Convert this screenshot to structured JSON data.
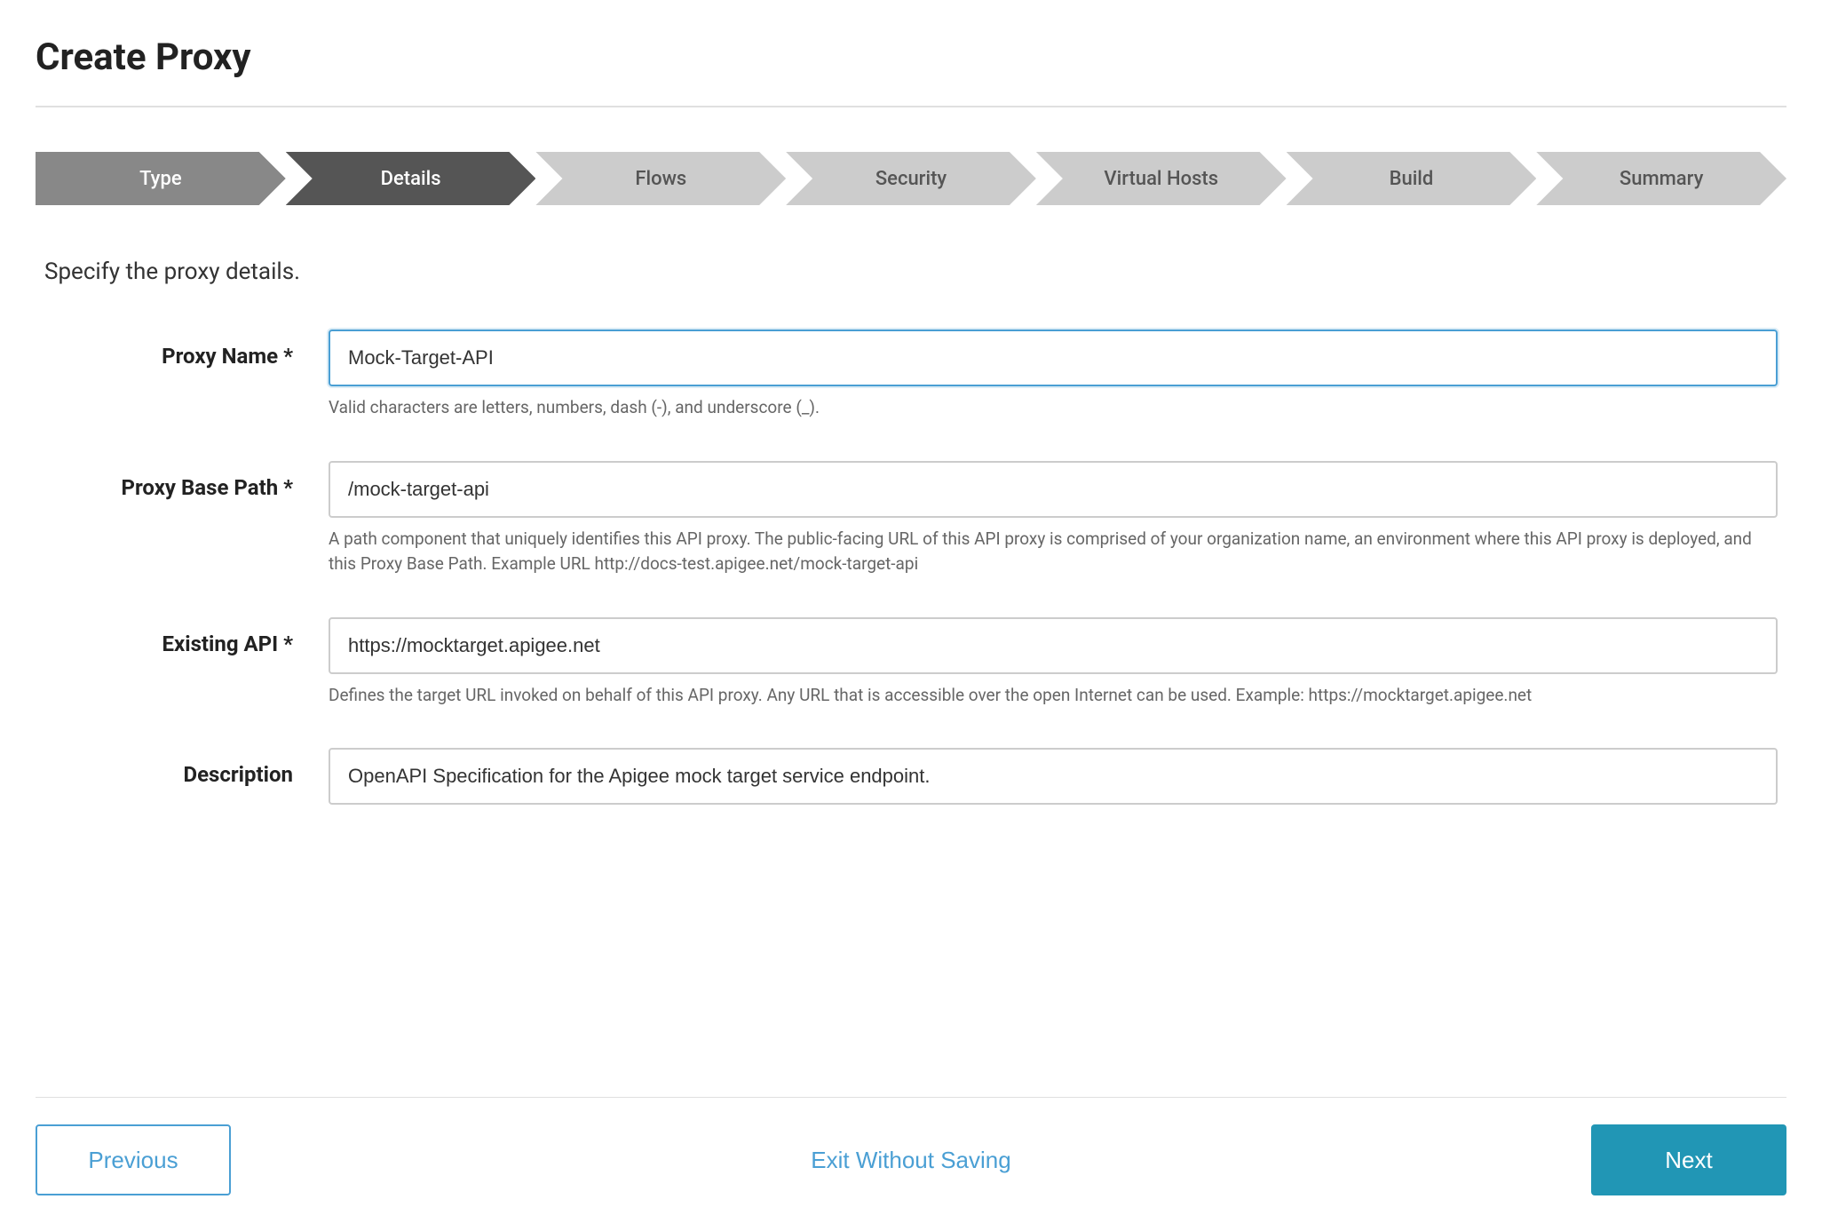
{
  "page": {
    "title": "Create Proxy"
  },
  "stepper": {
    "steps": [
      {
        "id": "type",
        "label": "Type",
        "state": "completed"
      },
      {
        "id": "details",
        "label": "Details",
        "state": "active"
      },
      {
        "id": "flows",
        "label": "Flows",
        "state": "inactive"
      },
      {
        "id": "security",
        "label": "Security",
        "state": "inactive"
      },
      {
        "id": "virtual-hosts",
        "label": "Virtual Hosts",
        "state": "inactive"
      },
      {
        "id": "build",
        "label": "Build",
        "state": "inactive"
      },
      {
        "id": "summary",
        "label": "Summary",
        "state": "inactive"
      }
    ]
  },
  "form": {
    "section_description": "Specify the proxy details.",
    "fields": {
      "proxy_name": {
        "label": "Proxy Name *",
        "value": "Mock-Target-API",
        "hint": "Valid characters are letters, numbers, dash (-), and underscore (_)."
      },
      "proxy_base_path": {
        "label": "Proxy Base Path *",
        "value": "/mock-target-api",
        "hint": "A path component that uniquely identifies this API proxy. The public-facing URL of this API proxy is comprised of your organization name, an environment where this API proxy is deployed, and this Proxy Base Path. Example URL http://docs-test.apigee.net/mock-target-api"
      },
      "existing_api": {
        "label": "Existing API *",
        "value": "https://mocktarget.apigee.net",
        "hint": "Defines the target URL invoked on behalf of this API proxy. Any URL that is accessible over the open Internet can be used. Example: https://mocktarget.apigee.net"
      },
      "description": {
        "label": "Description",
        "value": "OpenAPI Specification for the Apigee mock target service endpoint.",
        "hint": ""
      }
    }
  },
  "navigation": {
    "previous_label": "Previous",
    "exit_label": "Exit Without Saving",
    "next_label": "Next"
  }
}
